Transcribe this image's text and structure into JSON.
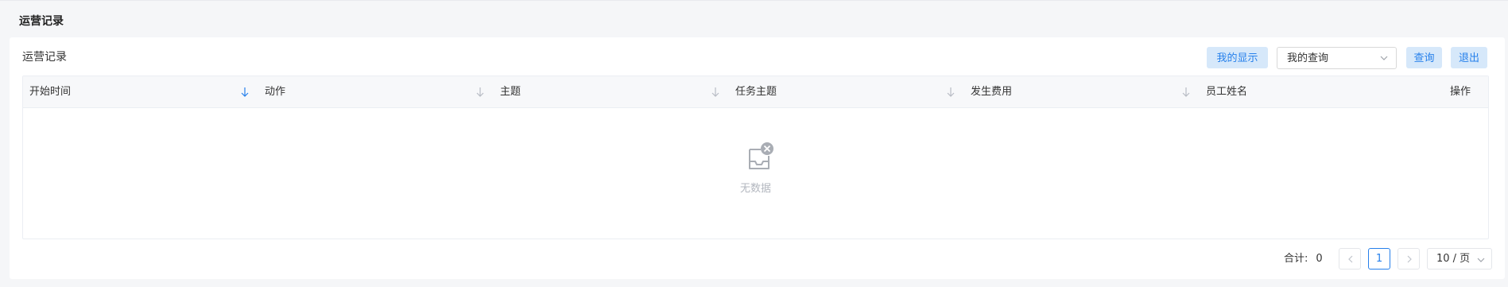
{
  "page": {
    "title": "运营记录"
  },
  "card": {
    "title": "运营记录",
    "toolbar": {
      "my_display_label": "我的显示",
      "my_query_selected": "我的查询",
      "query_label": "查询",
      "exit_label": "退出"
    }
  },
  "table": {
    "columns": [
      {
        "label": "开始时间",
        "sort_icon": "sort-arrow-down-icon",
        "sort_active": true
      },
      {
        "label": "动作",
        "sort_icon": "sort-arrow-down-icon",
        "sort_active": false
      },
      {
        "label": "主题",
        "sort_icon": "sort-arrow-down-icon",
        "sort_active": false
      },
      {
        "label": "任务主题",
        "sort_icon": "sort-arrow-down-icon",
        "sort_active": false
      },
      {
        "label": "发生费用",
        "sort_icon": "sort-arrow-down-icon",
        "sort_active": false
      },
      {
        "label": "员工姓名",
        "sort_icon": null,
        "sort_active": false
      }
    ],
    "actions_label": "操作",
    "rows": [],
    "empty_text": "无数据"
  },
  "pagination": {
    "total_label": "合计:",
    "total_value": "0",
    "current_page": "1",
    "page_size": "10 / 页"
  },
  "colors": {
    "accent": "#2680eb",
    "accent_light_bg": "#d6e8fa",
    "header_bg": "#f7f8fa",
    "page_bg": "#f5f6f8"
  }
}
